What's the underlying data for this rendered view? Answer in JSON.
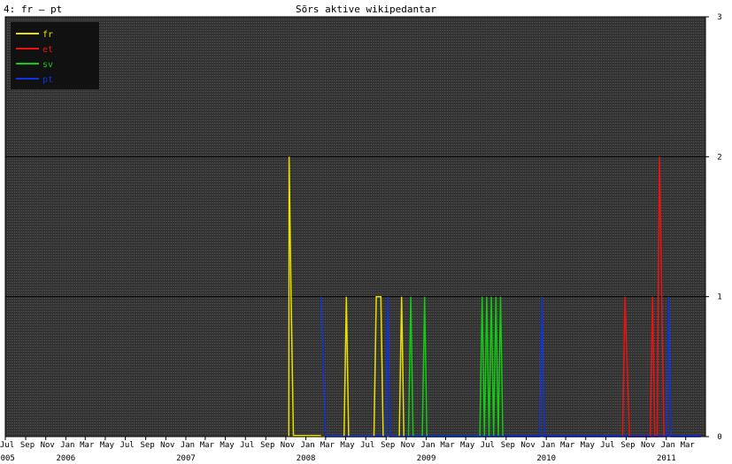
{
  "panel_label": "4: fr – pt",
  "chart_data": {
    "type": "line",
    "title": "Sõrs aktive wikipedantar",
    "xlabel": "",
    "ylabel": "",
    "ylim": [
      0,
      3
    ],
    "y_ticks": [
      "0",
      "1",
      "2",
      "3"
    ],
    "x_range": [
      "2005-07-01",
      "2011-04-30"
    ],
    "grid": true,
    "legend_position": "top-left",
    "month_labels": [
      {
        "date": "2005-07-01",
        "label": "Jul"
      },
      {
        "date": "2005-09-01",
        "label": "Sep"
      },
      {
        "date": "2005-11-01",
        "label": "Nov"
      },
      {
        "date": "2006-01-01",
        "label": "Jan"
      },
      {
        "date": "2006-03-01",
        "label": "Mar"
      },
      {
        "date": "2006-05-01",
        "label": "May"
      },
      {
        "date": "2006-07-01",
        "label": "Jul"
      },
      {
        "date": "2006-09-01",
        "label": "Sep"
      },
      {
        "date": "2006-11-01",
        "label": "Nov"
      },
      {
        "date": "2007-01-01",
        "label": "Jan"
      },
      {
        "date": "2007-03-01",
        "label": "Mar"
      },
      {
        "date": "2007-05-01",
        "label": "May"
      },
      {
        "date": "2007-07-01",
        "label": "Jul"
      },
      {
        "date": "2007-09-01",
        "label": "Sep"
      },
      {
        "date": "2007-11-01",
        "label": "Nov"
      },
      {
        "date": "2008-01-01",
        "label": "Jan"
      },
      {
        "date": "2008-03-01",
        "label": "Mar"
      },
      {
        "date": "2008-05-01",
        "label": "May"
      },
      {
        "date": "2008-07-01",
        "label": "Jul"
      },
      {
        "date": "2008-09-01",
        "label": "Sep"
      },
      {
        "date": "2008-11-01",
        "label": "Nov"
      },
      {
        "date": "2009-01-01",
        "label": "Jan"
      },
      {
        "date": "2009-03-01",
        "label": "Mar"
      },
      {
        "date": "2009-05-01",
        "label": "May"
      },
      {
        "date": "2009-07-01",
        "label": "Jul"
      },
      {
        "date": "2009-09-01",
        "label": "Sep"
      },
      {
        "date": "2009-11-01",
        "label": "Nov"
      },
      {
        "date": "2010-01-01",
        "label": "Jan"
      },
      {
        "date": "2010-03-01",
        "label": "Mar"
      },
      {
        "date": "2010-05-01",
        "label": "May"
      },
      {
        "date": "2010-07-01",
        "label": "Jul"
      },
      {
        "date": "2010-09-01",
        "label": "Sep"
      },
      {
        "date": "2010-11-01",
        "label": "Nov"
      },
      {
        "date": "2011-01-01",
        "label": "Jan"
      },
      {
        "date": "2011-03-01",
        "label": "Mar"
      }
    ],
    "year_labels": [
      {
        "date": "2005-07-01",
        "label": "2005"
      },
      {
        "date": "2006-01-01",
        "label": "2006"
      },
      {
        "date": "2007-01-01",
        "label": "2007"
      },
      {
        "date": "2008-01-01",
        "label": "2008"
      },
      {
        "date": "2009-01-01",
        "label": "2009"
      },
      {
        "date": "2010-01-01",
        "label": "2010"
      },
      {
        "date": "2011-01-01",
        "label": "2011"
      }
    ],
    "series": [
      {
        "name": "fr",
        "color": "#e8e000",
        "points": [
          [
            "2007-11-10",
            0
          ],
          [
            "2007-11-11",
            2
          ],
          [
            "2007-11-17",
            1
          ],
          [
            "2007-11-24",
            0
          ],
          [
            "2008-04-26",
            0
          ],
          [
            "2008-05-03",
            1
          ],
          [
            "2008-05-10",
            0
          ],
          [
            "2008-07-26",
            0
          ],
          [
            "2008-08-02",
            1
          ],
          [
            "2008-08-16",
            1
          ],
          [
            "2008-08-23",
            0
          ],
          [
            "2008-10-11",
            0
          ],
          [
            "2008-10-18",
            1
          ],
          [
            "2008-10-25",
            0
          ]
        ]
      },
      {
        "name": "et",
        "color": "#ee1111",
        "points": [
          [
            "2010-08-21",
            0
          ],
          [
            "2010-08-28",
            1
          ],
          [
            "2010-09-11",
            0
          ],
          [
            "2010-11-13",
            0
          ],
          [
            "2010-11-20",
            1
          ],
          [
            "2010-11-27",
            0
          ],
          [
            "2010-12-04",
            0
          ],
          [
            "2010-12-11",
            2
          ],
          [
            "2010-12-18",
            1
          ],
          [
            "2010-12-25",
            0
          ]
        ]
      },
      {
        "name": "sv",
        "color": "#11cc11",
        "points": [
          [
            "2008-11-08",
            0
          ],
          [
            "2008-11-15",
            1
          ],
          [
            "2008-11-22",
            0
          ],
          [
            "2008-12-20",
            0
          ],
          [
            "2008-12-27",
            1
          ],
          [
            "2009-01-03",
            0
          ],
          [
            "2009-06-13",
            0
          ],
          [
            "2009-06-20",
            1
          ],
          [
            "2009-06-27",
            0
          ],
          [
            "2009-07-04",
            1
          ],
          [
            "2009-07-11",
            0
          ],
          [
            "2009-07-18",
            1
          ],
          [
            "2009-07-25",
            0
          ],
          [
            "2009-08-01",
            1
          ],
          [
            "2009-08-08",
            0
          ],
          [
            "2009-08-15",
            1
          ],
          [
            "2009-08-22",
            0
          ]
        ]
      },
      {
        "name": "pt",
        "color": "#1133dd",
        "points": [
          [
            "2008-02-16",
            1
          ],
          [
            "2008-02-23",
            0.5
          ],
          [
            "2008-03-01",
            0
          ],
          [
            "2008-08-30",
            0
          ],
          [
            "2008-09-06",
            1
          ],
          [
            "2008-09-13",
            0
          ],
          [
            "2009-12-12",
            0
          ],
          [
            "2009-12-19",
            1
          ],
          [
            "2009-12-26",
            0
          ],
          [
            "2011-01-01",
            0
          ],
          [
            "2011-01-08",
            1
          ],
          [
            "2011-01-15",
            0
          ],
          [
            "2011-04-16",
            0
          ]
        ]
      }
    ]
  }
}
